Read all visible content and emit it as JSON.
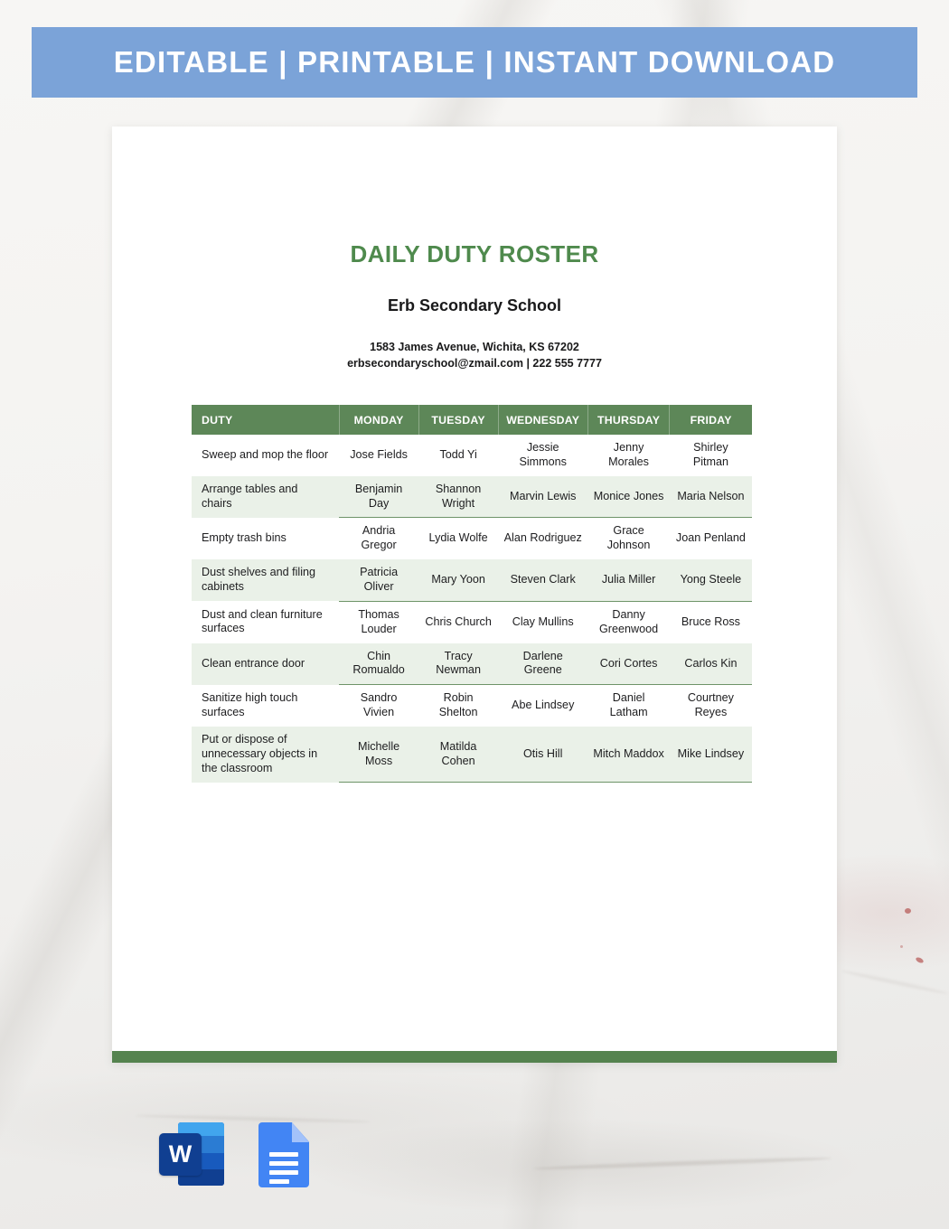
{
  "promo_banner": {
    "text": "EDITABLE  |  PRINTABLE  |  INSTANT DOWNLOAD",
    "background_color": "#7ba3d8",
    "text_color": "#ffffff"
  },
  "document": {
    "title": "DAILY DUTY ROSTER",
    "title_color": "#4f8a4d",
    "organization": "Erb Secondary School",
    "address": "1583 James Avenue, Wichita, KS 67202",
    "contact": "erbsecondaryschool@zmail.com | 222 555 7777",
    "footer_bar_color": "#55834f"
  },
  "table": {
    "header_background": "#5d8758",
    "shaded_row_background": "#eaf1e8",
    "divider_color": "#6e9468",
    "columns": [
      "DUTY",
      "MONDAY",
      "TUESDAY",
      "WEDNESDAY",
      "THURSDAY",
      "FRIDAY"
    ],
    "rows": [
      {
        "duty": "Sweep and mop the floor",
        "monday": "Jose Fields",
        "tuesday": "Todd Yi",
        "wednesday": "Jessie Simmons",
        "thursday": "Jenny Morales",
        "friday": "Shirley Pitman"
      },
      {
        "duty": "Arrange tables and chairs",
        "monday": "Benjamin Day",
        "tuesday": "Shannon Wright",
        "wednesday": "Marvin Lewis",
        "thursday": "Monice Jones",
        "friday": "Maria Nelson"
      },
      {
        "duty": "Empty trash bins",
        "monday": "Andria Gregor",
        "tuesday": "Lydia Wolfe",
        "wednesday": "Alan Rodriguez",
        "thursday": "Grace Johnson",
        "friday": "Joan Penland"
      },
      {
        "duty": "Dust shelves and filing cabinets",
        "monday": "Patricia Oliver",
        "tuesday": "Mary Yoon",
        "wednesday": "Steven Clark",
        "thursday": "Julia Miller",
        "friday": "Yong Steele"
      },
      {
        "duty": "Dust and clean furniture surfaces",
        "monday": "Thomas Louder",
        "tuesday": "Chris Church",
        "wednesday": "Clay Mullins",
        "thursday": "Danny Greenwood",
        "friday": "Bruce Ross"
      },
      {
        "duty": "Clean entrance door",
        "monday": "Chin Romualdo",
        "tuesday": "Tracy Newman",
        "wednesday": "Darlene Greene",
        "thursday": "Cori Cortes",
        "friday": "Carlos Kin"
      },
      {
        "duty": "Sanitize high touch surfaces",
        "monday": "Sandro Vivien",
        "tuesday": "Robin Shelton",
        "wednesday": "Abe Lindsey",
        "thursday": "Daniel Latham",
        "friday": "Courtney Reyes"
      },
      {
        "duty": "Put or dispose of unnecessary objects in the classroom",
        "monday": "Michelle Moss",
        "tuesday": "Matilda Cohen",
        "wednesday": "Otis Hill",
        "thursday": "Mitch Maddox",
        "friday": "Mike Lindsey"
      }
    ]
  },
  "format_icons": [
    {
      "name": "microsoft-word-icon",
      "label": "W"
    },
    {
      "name": "google-docs-icon",
      "label": ""
    }
  ]
}
